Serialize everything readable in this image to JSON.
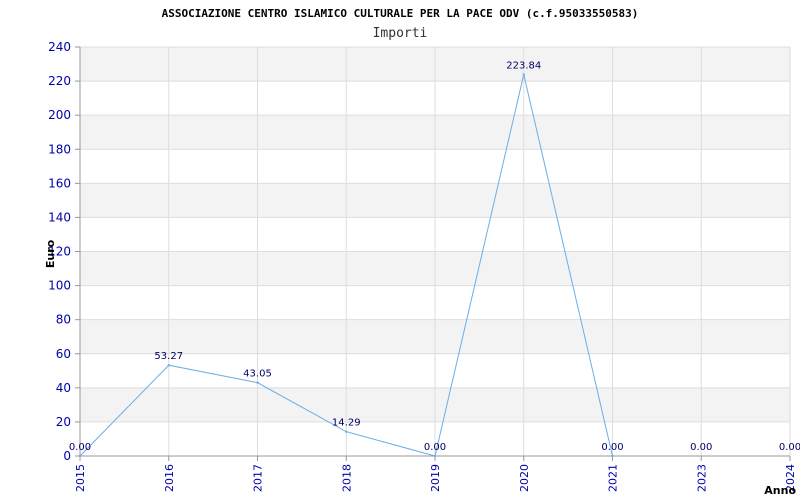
{
  "chart_data": {
    "type": "line",
    "title": "ASSOCIAZIONE CENTRO ISLAMICO CULTURALE PER LA PACE ODV (c.f.95033550583)",
    "subtitle": "Importi",
    "xlabel": "Anno",
    "ylabel": "Euro",
    "x": [
      "2015",
      "2016",
      "2017",
      "2018",
      "2019",
      "2020",
      "2021",
      "2023",
      "2024"
    ],
    "values": [
      0.0,
      53.27,
      43.05,
      14.29,
      0.0,
      223.84,
      0.0,
      null,
      null
    ],
    "value_labels": [
      "0.00",
      "53.27",
      "43.05",
      "14.29",
      "0.00",
      "223.84",
      "0.00",
      "0.00",
      "0.00"
    ],
    "ylim": [
      0,
      240
    ],
    "yticks": [
      0,
      20,
      40,
      60,
      80,
      100,
      120,
      140,
      160,
      180,
      200,
      220,
      240
    ],
    "grid": true,
    "colors": {
      "line": "#6aaee8",
      "band": "#f3f3f3",
      "grid": "#dddddd",
      "tick_text": "#0000aa",
      "value_text": "#000066"
    }
  }
}
